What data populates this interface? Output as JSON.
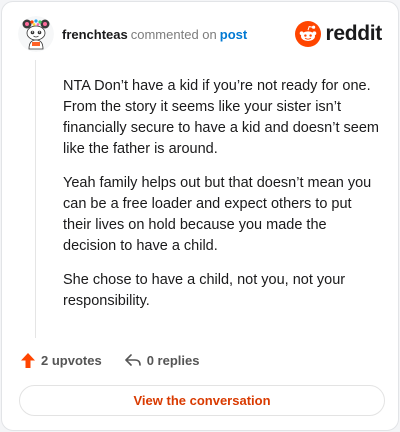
{
  "header": {
    "username": "frenchteas",
    "action_text": "commented on",
    "post_link": "post"
  },
  "brand": {
    "icon": "reddit-snoo-icon",
    "wordmark": "reddit",
    "color": "#ff4500"
  },
  "avatar": {
    "icon": "snoo-avatar-icon"
  },
  "comment": {
    "paragraphs": [
      "NTA Don’t have a kid if you’re not ready for one. From the story it seems like your sister isn’t financially secure to have a kid and doesn’t seem like the father is around.",
      "Yeah family helps out but that doesn’t mean you can be a free loader and expect others to put their lives on hold because you made the decision to have a child.",
      "She chose to have a child, not you, not your responsibility."
    ]
  },
  "actions": {
    "upvotes_label": "2 upvotes",
    "upvote_icon": "upvote-arrow-icon",
    "upvote_color": "#ff4500",
    "replies_label": "0 replies",
    "reply_icon": "reply-arrow-icon"
  },
  "footer": {
    "button_label": "View the conversation",
    "button_color": "#d93a00"
  }
}
